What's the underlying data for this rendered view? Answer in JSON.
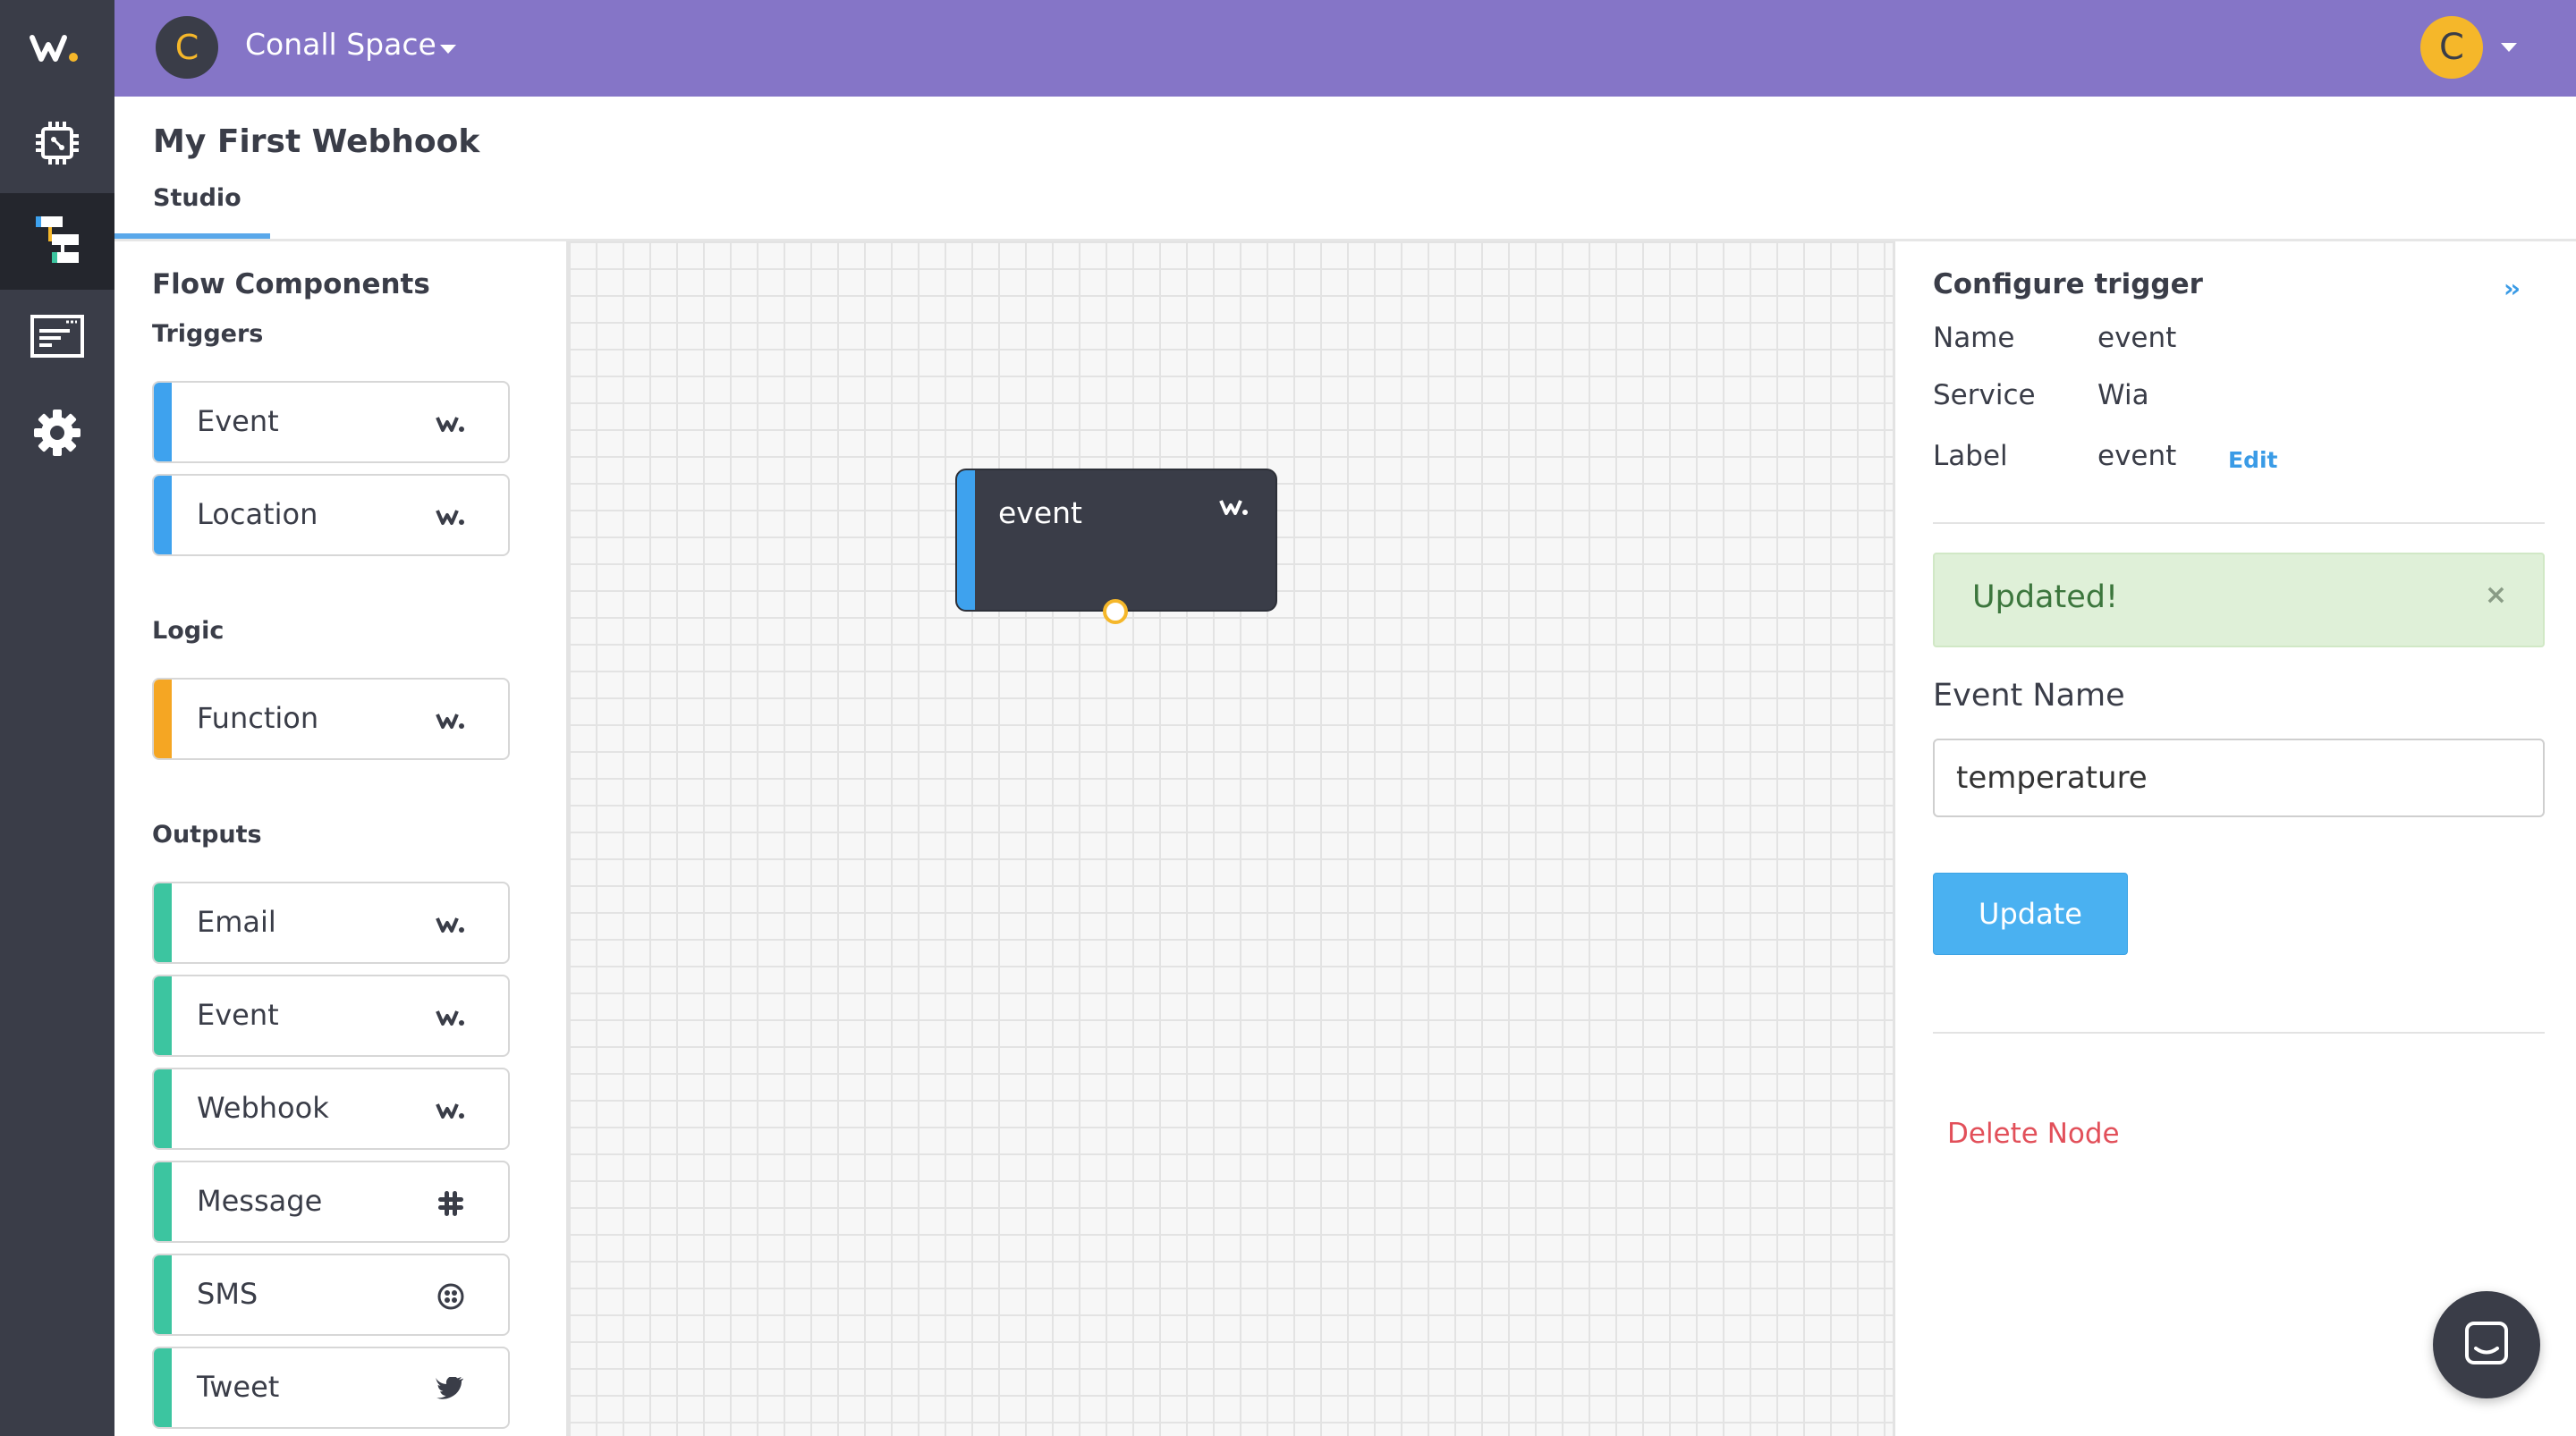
{
  "brand": {
    "logo_icon": "wia-logo-icon",
    "accent": "#8575c7",
    "rail_bg": "#3a3d48"
  },
  "rail": {
    "items": [
      {
        "icon": "chip-icon",
        "active": false
      },
      {
        "icon": "flow-icon",
        "active": true
      },
      {
        "icon": "dashboard-icon",
        "active": false
      },
      {
        "icon": "gear-icon",
        "active": false
      }
    ]
  },
  "topbar": {
    "space_avatar_letter": "C",
    "space_name": "Conall Space",
    "user_avatar_letter": "C"
  },
  "header": {
    "title": "My First Webhook",
    "tabs": [
      {
        "label": "Studio",
        "active": true
      }
    ]
  },
  "components": {
    "title": "Flow Components",
    "sections": [
      {
        "label": "Triggers",
        "color": "#3ea2ee",
        "items": [
          {
            "label": "Event",
            "icon": "wia-icon"
          },
          {
            "label": "Location",
            "icon": "wia-icon"
          }
        ]
      },
      {
        "label": "Logic",
        "color": "#f5a623",
        "items": [
          {
            "label": "Function",
            "icon": "wia-icon"
          }
        ]
      },
      {
        "label": "Outputs",
        "color": "#3cc5a0",
        "items": [
          {
            "label": "Email",
            "icon": "wia-icon"
          },
          {
            "label": "Event",
            "icon": "wia-icon"
          },
          {
            "label": "Webhook",
            "icon": "wia-icon"
          },
          {
            "label": "Message",
            "icon": "slack-icon"
          },
          {
            "label": "SMS",
            "icon": "twilio-icon"
          },
          {
            "label": "Tweet",
            "icon": "twitter-icon"
          }
        ]
      }
    ]
  },
  "canvas": {
    "nodes": [
      {
        "label": "event",
        "icon": "wia-icon"
      }
    ]
  },
  "config": {
    "title": "Configure trigger",
    "collapse": "››",
    "fields": [
      {
        "key": "Name",
        "value": "event"
      },
      {
        "key": "Service",
        "value": "Wia"
      },
      {
        "key": "Label",
        "value": "event"
      }
    ],
    "edit_label": "Edit",
    "alert": {
      "text": "Updated!",
      "close": "×",
      "color": "#dff0d8"
    },
    "event_name_label": "Event Name",
    "event_name_value": "temperature",
    "update_label": "Update",
    "delete_label": "Delete Node"
  }
}
